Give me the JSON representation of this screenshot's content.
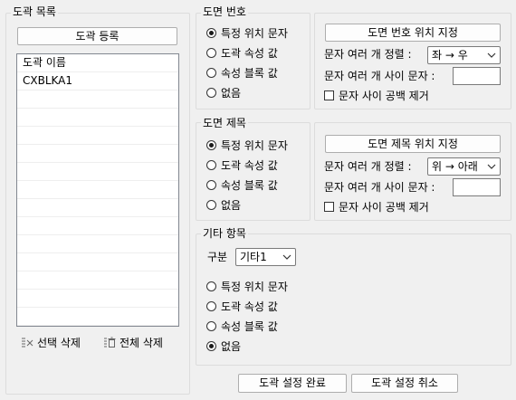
{
  "drawing_list": {
    "title": "도곽 목록",
    "register_label": "도곽 등록",
    "items": [
      "도곽 이름",
      "CXBLKA1",
      "",
      "",
      "",
      "",
      "",
      "",
      "",
      "",
      "",
      "",
      "",
      "",
      ""
    ],
    "delete_selected_label": "선택 삭제",
    "delete_all_label": "전체 삭제"
  },
  "drawing_number": {
    "title": "도면 번호",
    "options": [
      "특정 위치 문자",
      "도곽 속성 값",
      "속성 블록 값",
      "없음"
    ],
    "selected_index": 0,
    "set_position_label": "도면 번호 위치 지정",
    "sort_label": "문자 여러 개 정렬 :",
    "sort_value": "좌 → 우",
    "separator_label": "문자 여러 개 사이 문자 :",
    "separator_value": "",
    "remove_spaces_label": "문자 사이 공백 제거",
    "remove_spaces_checked": false
  },
  "drawing_title": {
    "title": "도면 제목",
    "options": [
      "특정 위치 문자",
      "도곽 속성 값",
      "속성 블록 값",
      "없음"
    ],
    "selected_index": 0,
    "set_position_label": "도면 제목 위치 지정",
    "sort_label": "문자 여러 개 정렬 :",
    "sort_value": "위 → 아래",
    "separator_label": "문자 여러 개 사이 문자 :",
    "separator_value": "",
    "remove_spaces_label": "문자 사이 공백 제거",
    "remove_spaces_checked": false
  },
  "other_items": {
    "title": "기타 항목",
    "category_label": "구분",
    "category_value": "기타1",
    "options": [
      "특정 위치 문자",
      "도곽 속성 값",
      "속성 블록 값",
      "없음"
    ],
    "selected_index": 3
  },
  "footer": {
    "complete_label": "도곽 설정 완료",
    "cancel_label": "도곽 설정 취소"
  }
}
